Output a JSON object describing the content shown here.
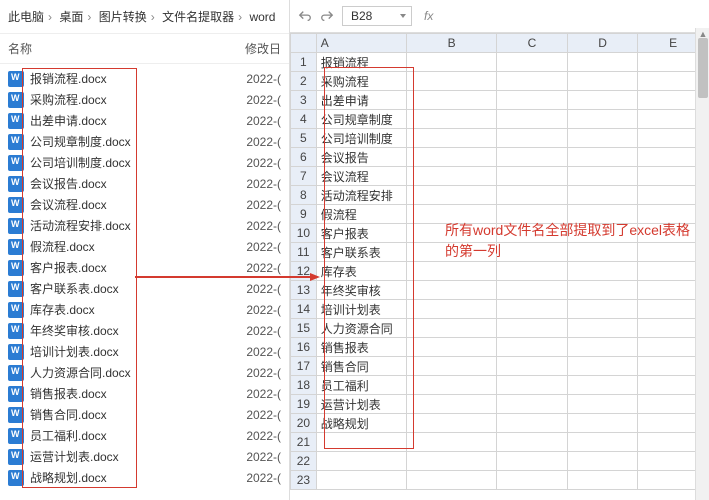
{
  "breadcrumb": [
    "此电脑",
    "桌面",
    "图片转换",
    "文件名提取器",
    "word"
  ],
  "explorer_headers": {
    "name": "名称",
    "date": "修改日"
  },
  "files": [
    {
      "name": "报销流程.docx",
      "date": "2022-("
    },
    {
      "name": "采购流程.docx",
      "date": "2022-("
    },
    {
      "name": "出差申请.docx",
      "date": "2022-("
    },
    {
      "name": "公司规章制度.docx",
      "date": "2022-("
    },
    {
      "name": "公司培训制度.docx",
      "date": "2022-("
    },
    {
      "name": "会议报告.docx",
      "date": "2022-("
    },
    {
      "name": "会议流程.docx",
      "date": "2022-("
    },
    {
      "name": "活动流程安排.docx",
      "date": "2022-("
    },
    {
      "name": "假流程.docx",
      "date": "2022-("
    },
    {
      "name": "客户报表.docx",
      "date": "2022-("
    },
    {
      "name": "客户联系表.docx",
      "date": "2022-("
    },
    {
      "name": "库存表.docx",
      "date": "2022-("
    },
    {
      "name": "年终奖审核.docx",
      "date": "2022-("
    },
    {
      "name": "培训计划表.docx",
      "date": "2022-("
    },
    {
      "name": "人力资源合同.docx",
      "date": "2022-("
    },
    {
      "name": "销售报表.docx",
      "date": "2022-("
    },
    {
      "name": "销售合同.docx",
      "date": "2022-("
    },
    {
      "name": "员工福利.docx",
      "date": "2022-("
    },
    {
      "name": "运营计划表.docx",
      "date": "2022-("
    },
    {
      "name": "战略规划.docx",
      "date": "2022-("
    }
  ],
  "name_box": "B28",
  "fx_label": "fx",
  "col_headers": [
    "A",
    "B",
    "C",
    "D",
    "E"
  ],
  "cells_a": [
    "报销流程",
    "采购流程",
    "出差申请",
    "公司规章制度",
    "公司培训制度",
    "会议报告",
    "会议流程",
    "活动流程安排",
    "假流程",
    "客户报表",
    "客户联系表",
    "库存表",
    "年终奖审核",
    "培训计划表",
    "人力资源合同",
    "销售报表",
    "销售合同",
    "员工福利",
    "运营计划表",
    "战略规划",
    "",
    "",
    ""
  ],
  "annotation": "所有word文件名全部提取到了excel表格的第一列"
}
